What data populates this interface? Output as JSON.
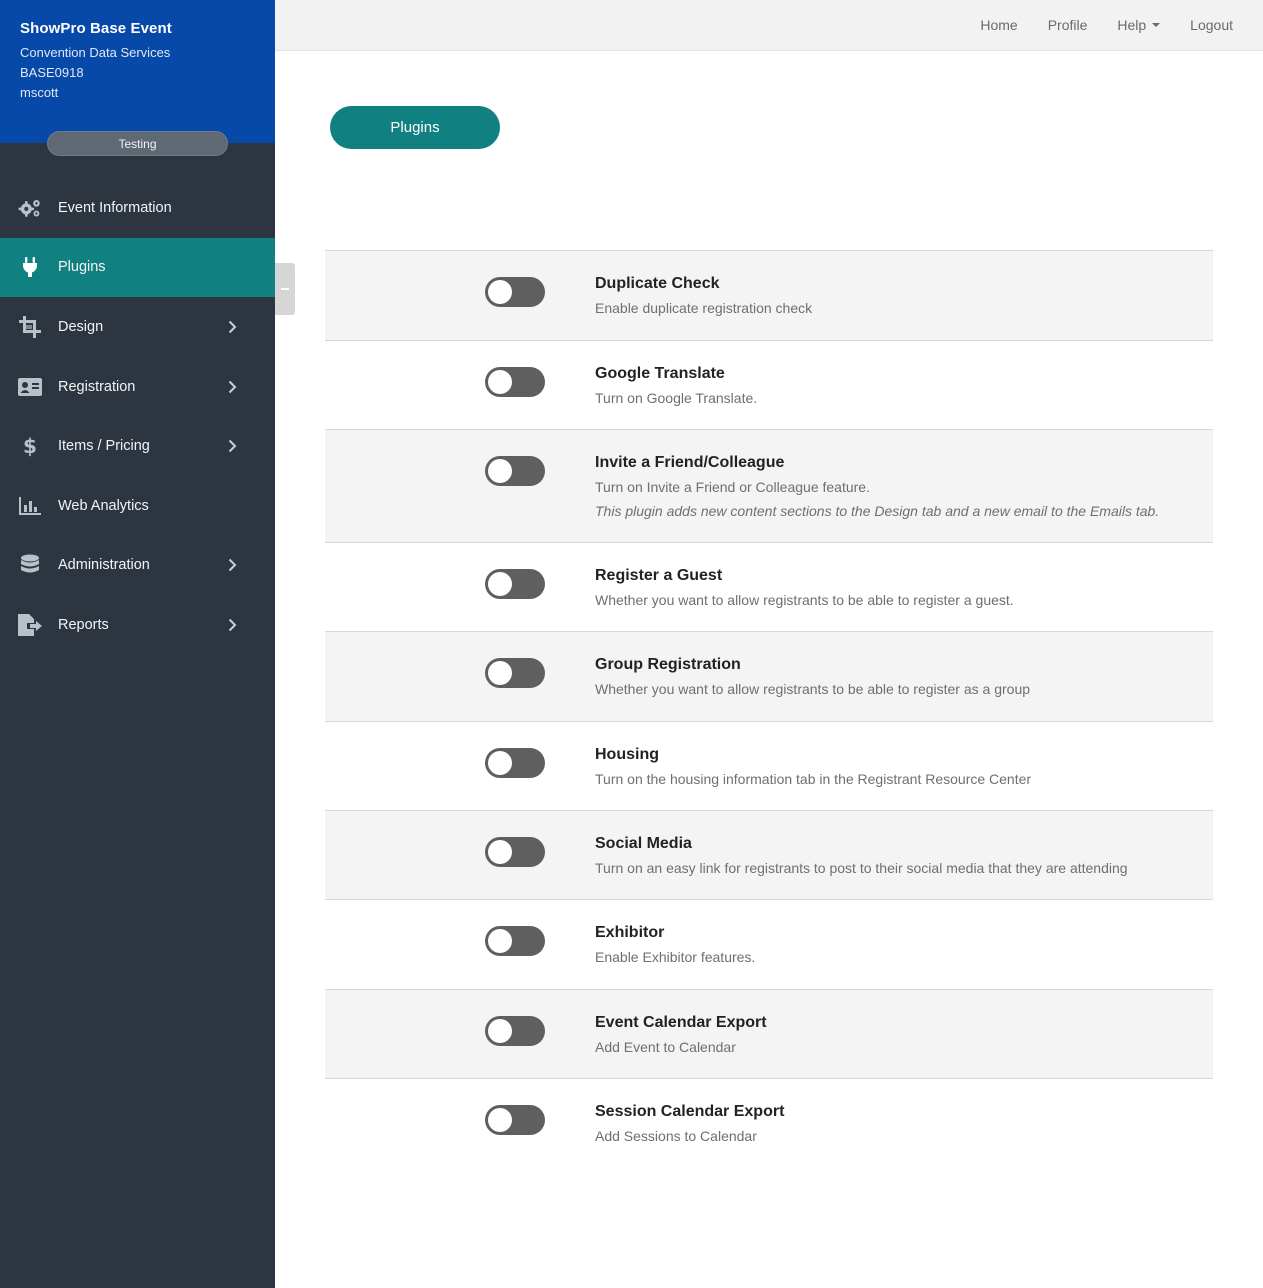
{
  "sidebar": {
    "event_name": "ShowPro Base Event",
    "company": "Convention Data Services",
    "event_code": "BASE0918",
    "username": "mscott",
    "environment": "Testing",
    "items": [
      {
        "label": "Event Information",
        "icon": "gears-icon",
        "active": false,
        "has_submenu": false
      },
      {
        "label": "Plugins",
        "icon": "plug-icon",
        "active": true,
        "has_submenu": false
      },
      {
        "label": "Design",
        "icon": "crop-icon",
        "active": false,
        "has_submenu": true
      },
      {
        "label": "Registration",
        "icon": "id-card-icon",
        "active": false,
        "has_submenu": true
      },
      {
        "label": "Items / Pricing",
        "icon": "dollar-icon",
        "active": false,
        "has_submenu": true
      },
      {
        "label": "Web Analytics",
        "icon": "bar-chart-icon",
        "active": false,
        "has_submenu": false
      },
      {
        "label": "Administration",
        "icon": "database-icon",
        "active": false,
        "has_submenu": true
      },
      {
        "label": "Reports",
        "icon": "export-file-icon",
        "active": false,
        "has_submenu": true
      }
    ]
  },
  "topnav": {
    "home": "Home",
    "profile": "Profile",
    "help": "Help",
    "logout": "Logout"
  },
  "main": {
    "section_button": "Plugins",
    "plugins": [
      {
        "title": "Duplicate Check",
        "description": "Enable duplicate registration check",
        "note": "",
        "enabled": false
      },
      {
        "title": "Google Translate",
        "description": "Turn on Google Translate.",
        "note": "",
        "enabled": false
      },
      {
        "title": "Invite a Friend/Colleague",
        "description": "Turn on Invite a Friend or Colleague feature.",
        "note": "This plugin adds new content sections to the Design tab and a new email to the Emails tab.",
        "enabled": false
      },
      {
        "title": "Register a Guest",
        "description": "Whether you want to allow registrants to be able to register a guest.",
        "note": "",
        "enabled": false
      },
      {
        "title": "Group Registration",
        "description": "Whether you want to allow registrants to be able to register as a group",
        "note": "",
        "enabled": false
      },
      {
        "title": "Housing",
        "description": "Turn on the housing information tab in the Registrant Resource Center",
        "note": "",
        "enabled": false
      },
      {
        "title": "Social Media",
        "description": "Turn on an easy link for registrants to post to their social media that they are attending",
        "note": "",
        "enabled": false
      },
      {
        "title": "Exhibitor",
        "description": "Enable Exhibitor features.",
        "note": "",
        "enabled": false
      },
      {
        "title": "Event Calendar Export",
        "description": "Add Event to Calendar",
        "note": "",
        "enabled": false
      },
      {
        "title": "Session Calendar Export",
        "description": "Add Sessions to Calendar",
        "note": "",
        "enabled": false
      }
    ]
  },
  "colors": {
    "sidebar_header": "#0749a8",
    "sidebar_bg": "#2c3540",
    "accent_teal": "#108080",
    "toggle_off": "#5f5f5f"
  }
}
